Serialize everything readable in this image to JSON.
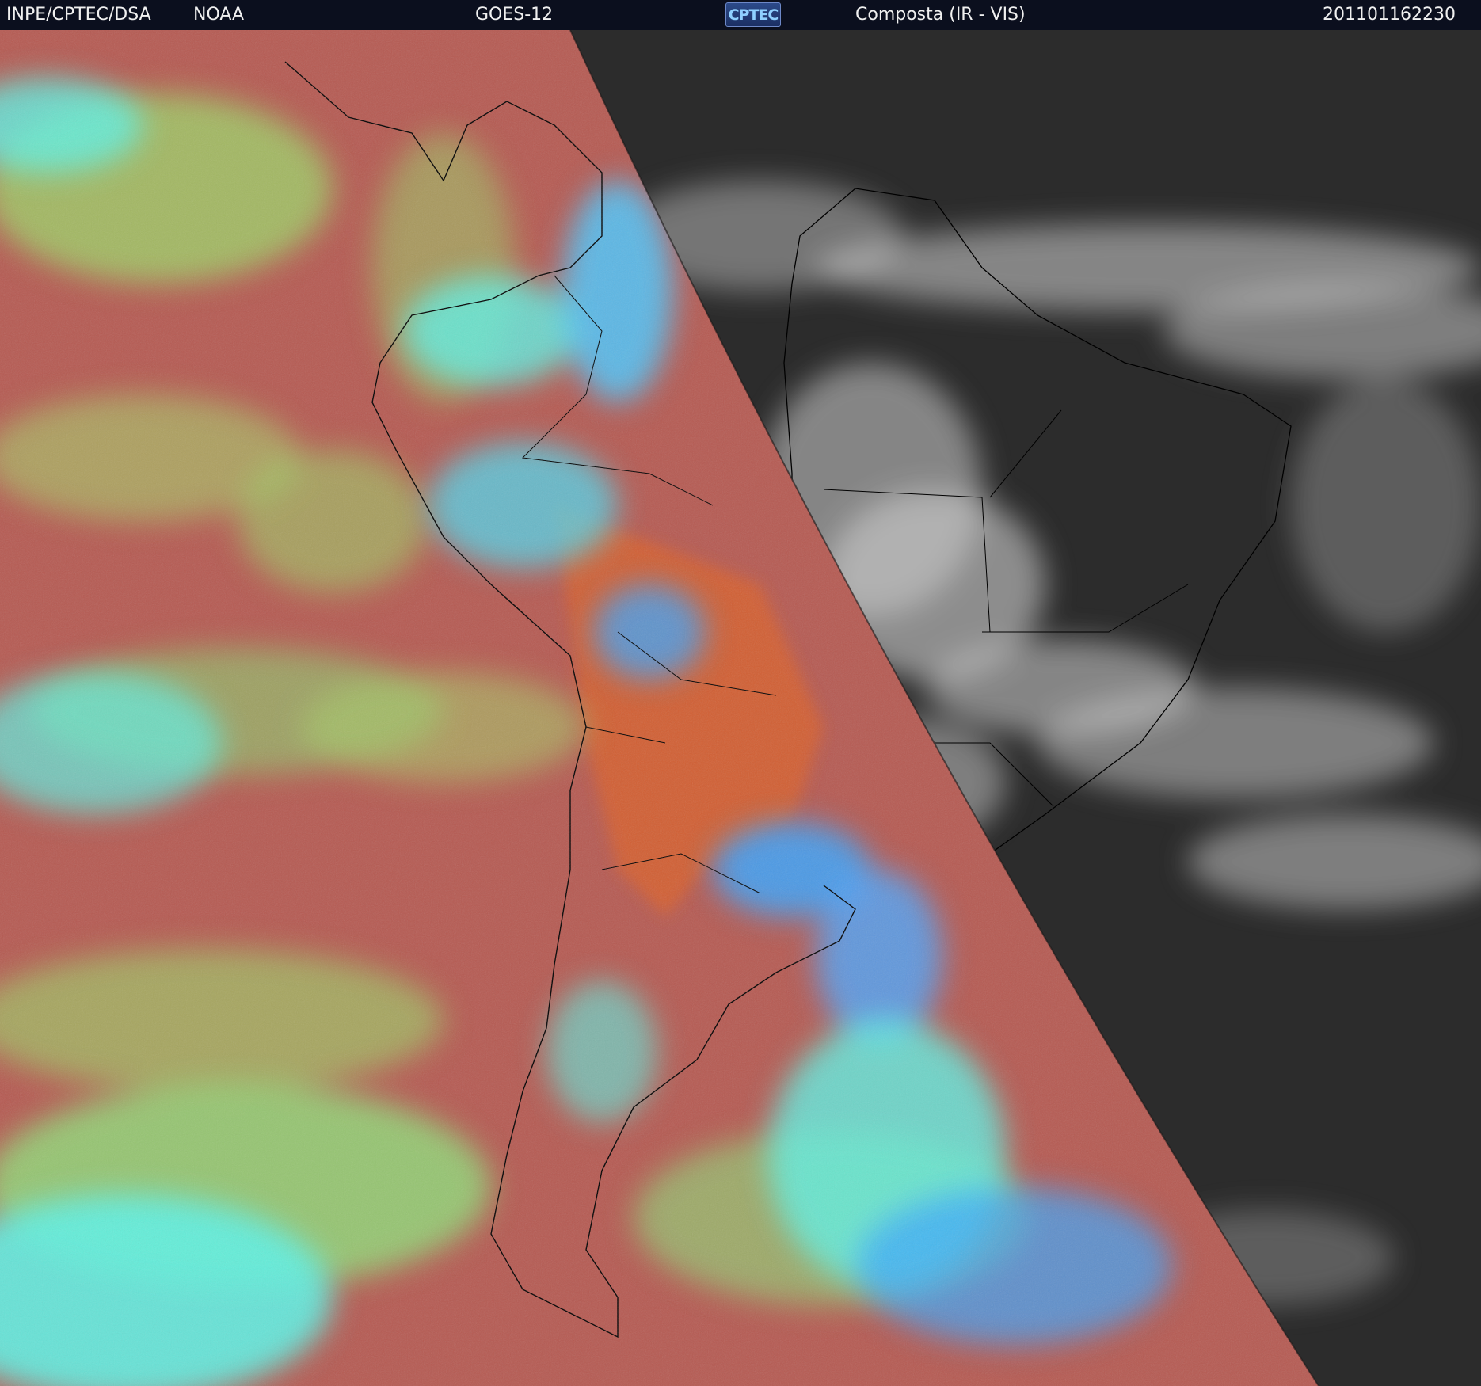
{
  "header": {
    "institution": "INPE/CPTEC/DSA",
    "agency": "NOAA",
    "satellite": "GOES-12",
    "logo_text": "CPTEC",
    "product": "Composta (IR - VIS)",
    "timestamp": "201101162230"
  },
  "colors": {
    "header_bg": "#0b0f1e",
    "ir_base": "#b65a52",
    "ir_orange": "#d8602e",
    "cloud_green": "#9cd86a",
    "cloud_cyan": "#5ef2e6",
    "cloud_blue": "#3aa6ff",
    "vis_dark": "#2c2c2c",
    "vis_cloud": "#d8d8d8",
    "coastline": "#000000"
  }
}
